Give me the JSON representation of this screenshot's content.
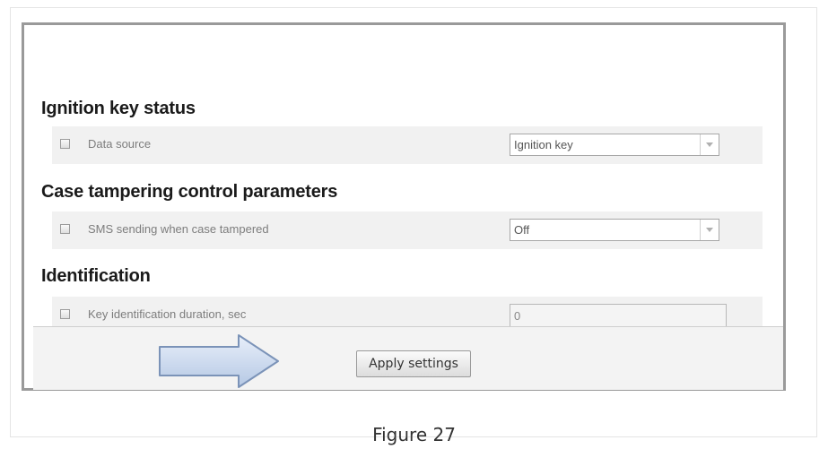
{
  "sections": [
    {
      "title": "Ignition key status",
      "row": {
        "label": "Data source",
        "control": "select",
        "value": "Ignition key",
        "checked": false
      }
    },
    {
      "title": "Case tampering control parameters",
      "row": {
        "label": "SMS sending when case tampered",
        "control": "select",
        "value": "Off",
        "checked": false
      }
    },
    {
      "title": "Identification",
      "row": {
        "label": "Key identification duration, sec",
        "control": "input",
        "value": "0",
        "checked": false
      }
    }
  ],
  "footer": {
    "apply_label": "Apply settings"
  },
  "icons": {
    "arrow": "right-arrow-icon",
    "dropdown": "chevron-down-icon",
    "checkbox": "checkbox-icon"
  },
  "caption": "Figure 27",
  "colors": {
    "panel_border": "#9a9a9a",
    "row_bg": "#f1f1f1",
    "arrow_fill": "#c9d8ee",
    "arrow_stroke": "#7b93b8"
  }
}
